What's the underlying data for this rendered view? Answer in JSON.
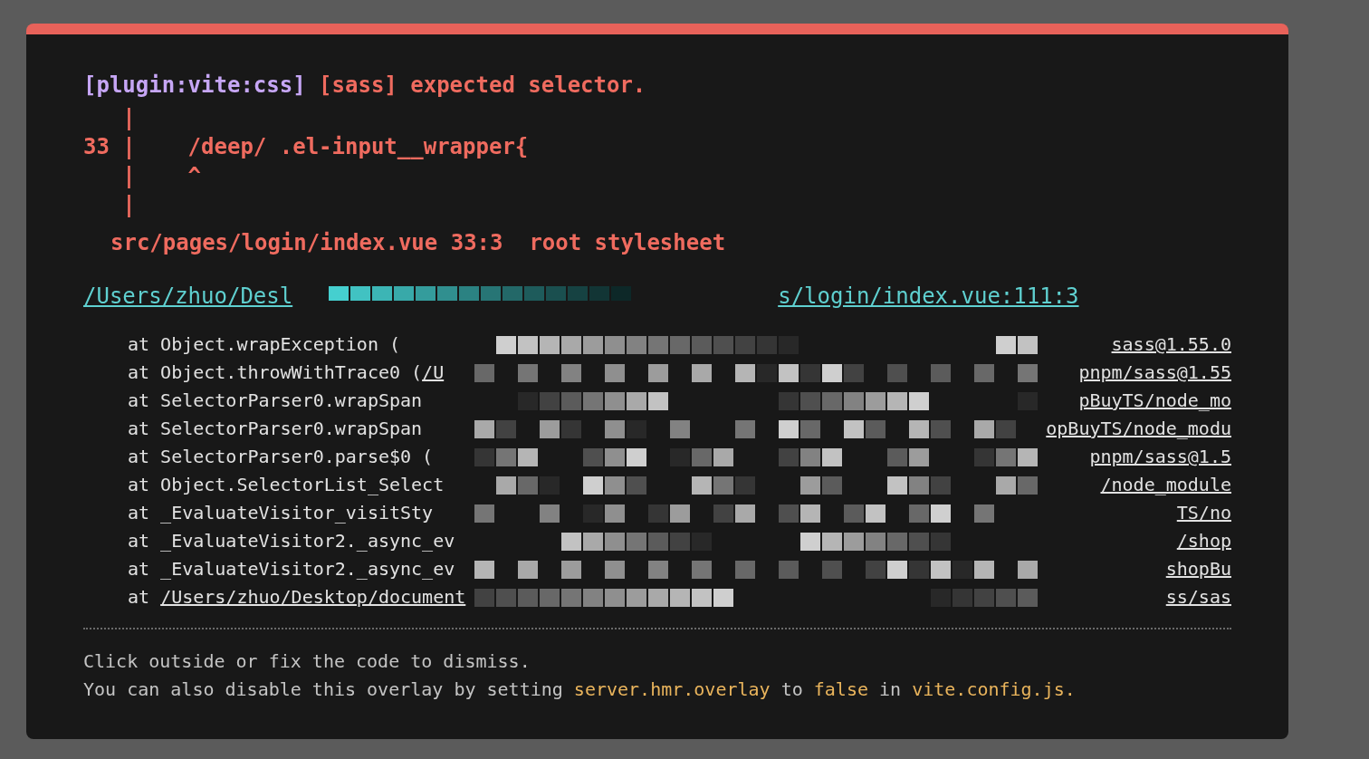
{
  "message": {
    "plugin": "[plugin:vite:css]",
    "text": "[sass] expected selector."
  },
  "code_frame": [
    "   |",
    "33 |    /deep/ .el-input__wrapper{",
    "   |    ^",
    "   |"
  ],
  "location": "src/pages/login/index.vue 33:3  root stylesheet",
  "file_link": {
    "start": "/Users/zhuo/Desl",
    "end": "s/login/index.vue:111:3"
  },
  "stack": [
    {
      "text": "at Object.wrapException (",
      "tail": "sass@1.55.0"
    },
    {
      "text": "at Object.throwWithTrace0 (",
      "link": "/U",
      "tail": "pnpm/sass@1.55"
    },
    {
      "text": "at SelectorParser0.wrapSpan",
      "tail": "pBuyTS/node_mo"
    },
    {
      "text": "at SelectorParser0.wrapSpan",
      "tail": "opBuyTS/node_modu"
    },
    {
      "text": "at SelectorParser0.parse$0 (",
      "tail": "pnpm/sass@1.5"
    },
    {
      "text": "at Object.SelectorList_Select",
      "tail": "/node_module"
    },
    {
      "text": "at _EvaluateVisitor_visitSty",
      "tail": "TS/no"
    },
    {
      "text": "at _EvaluateVisitor2._async_ev",
      "tail": "/shop"
    },
    {
      "text": "at _EvaluateVisitor2._async_ev",
      "tail": "shopBu"
    },
    {
      "text": "at ",
      "link": "/Users/zhuo/Desktop/document",
      "tail": "ss/sas"
    }
  ],
  "tip": "Click outside or fix the code to dismiss.",
  "hint": [
    {
      "kind": "plain",
      "text": "You can also disable this overlay by setting "
    },
    {
      "kind": "code",
      "text": "server.hmr.overlay"
    },
    {
      "kind": "plain",
      "text": " to "
    },
    {
      "kind": "code",
      "text": "false"
    },
    {
      "kind": "plain",
      "text": " in "
    },
    {
      "kind": "code",
      "text": "vite.config.js."
    }
  ]
}
